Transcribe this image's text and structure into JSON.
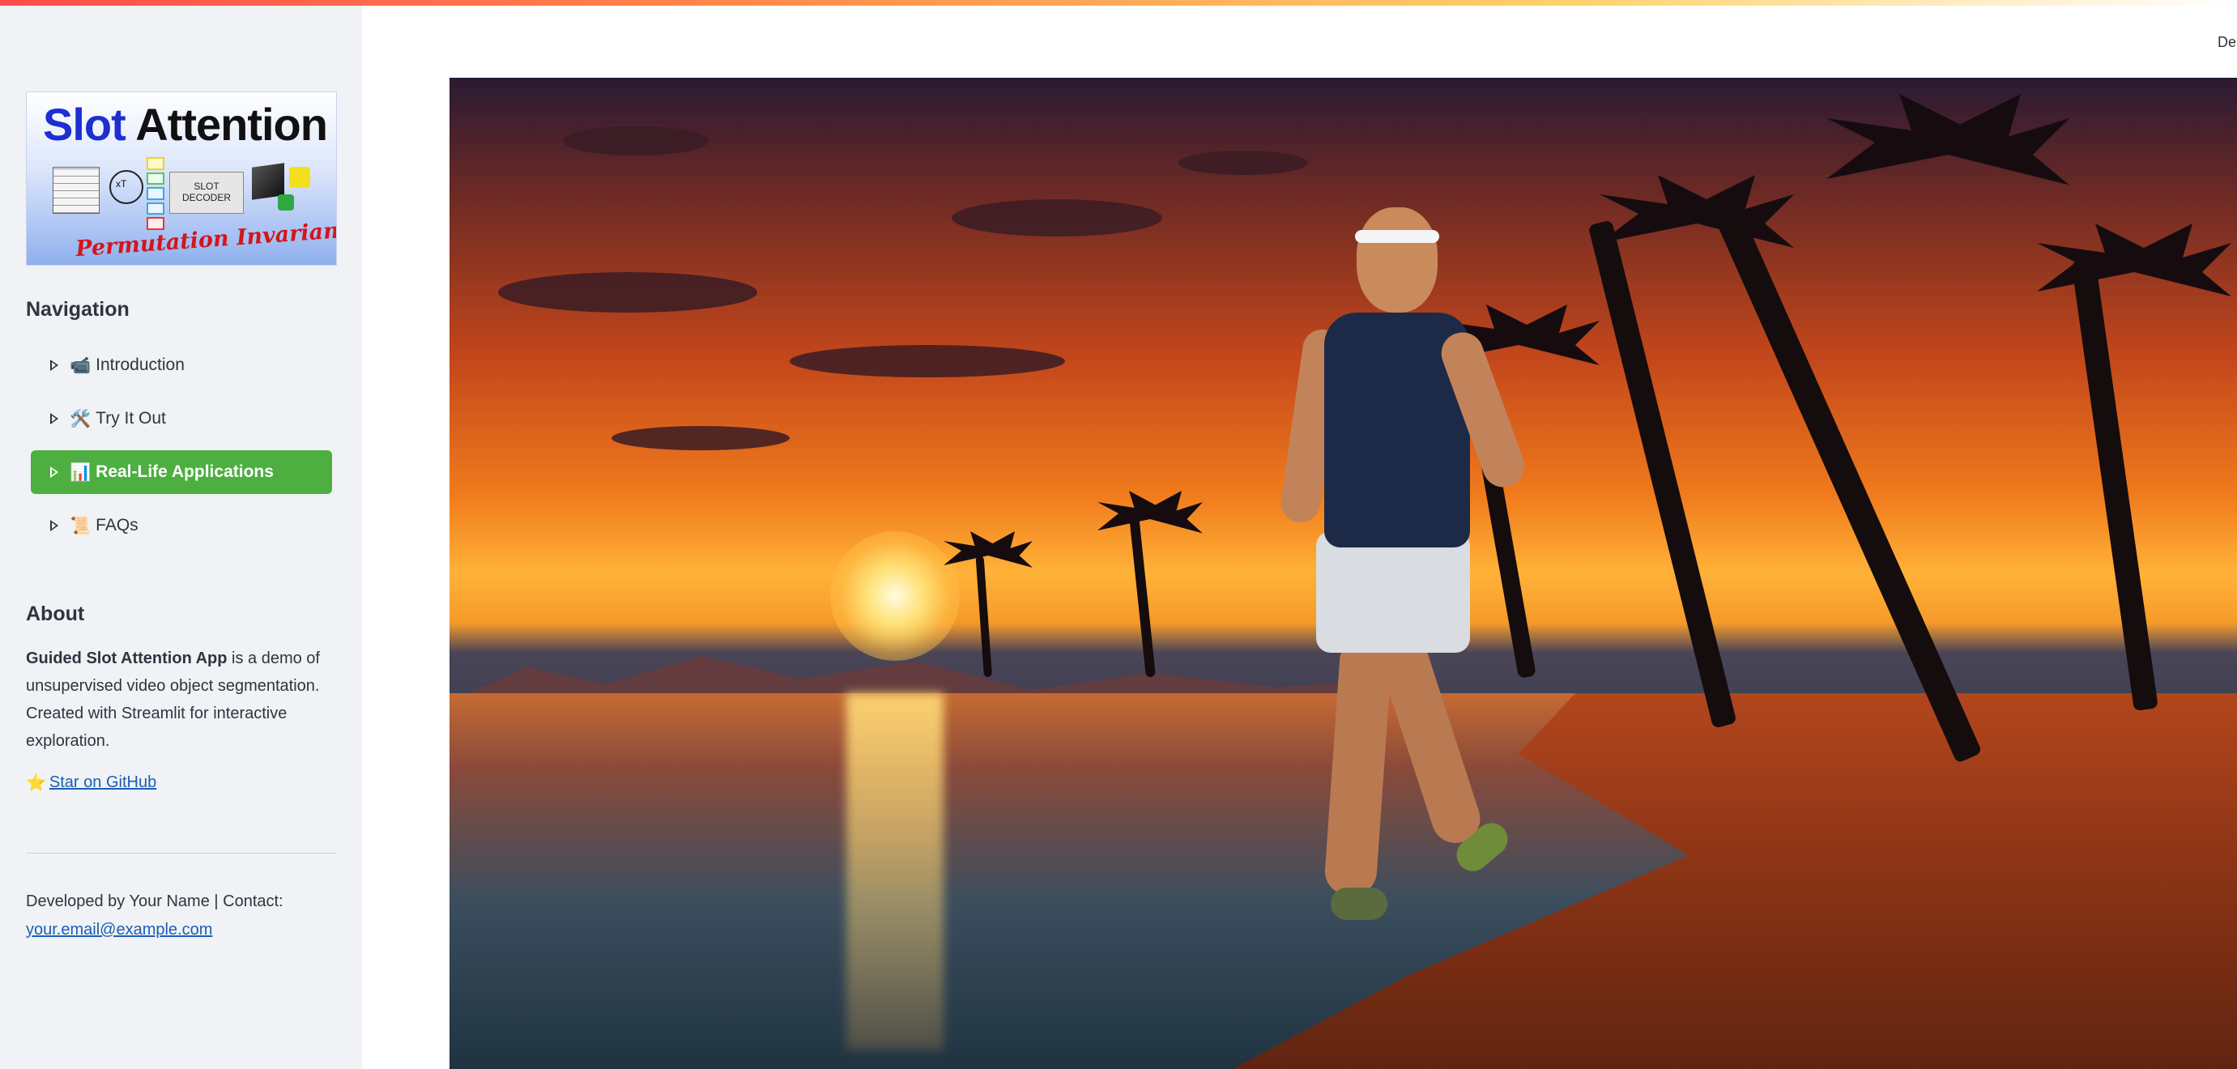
{
  "sidebar": {
    "logo": {
      "title_part1": "Slot",
      "title_part2": "Attention",
      "decoder_line1": "SLOT",
      "decoder_line2": "DECODER",
      "transform_symbol": "xT",
      "subtitle": "Permutation Invariant!"
    },
    "nav_heading": "Navigation",
    "nav_items": [
      {
        "emoji": "📹",
        "label": "Introduction",
        "active": false
      },
      {
        "emoji": "🛠️",
        "label": "Try It Out",
        "active": false
      },
      {
        "emoji": "📊",
        "label": "Real-Life Applications",
        "active": true
      },
      {
        "emoji": "📜",
        "label": "FAQs",
        "active": false
      }
    ],
    "about_heading": "About",
    "about_bold": "Guided Slot Attention App",
    "about_rest": " is a demo of unsupervised video object segmentation. Created with Streamlit for interactive exploration.",
    "star_emoji": "⭐",
    "github_link": "Star on GitHub",
    "footer_text": "Developed by Your Name | Contact:",
    "footer_email": "your.email@example.com"
  },
  "header": {
    "deploy_label": "Deploy"
  },
  "colors": {
    "accent_green": "#4caf3f",
    "sidebar_bg": "#f0f2f6",
    "link": "#1a5fb4"
  }
}
